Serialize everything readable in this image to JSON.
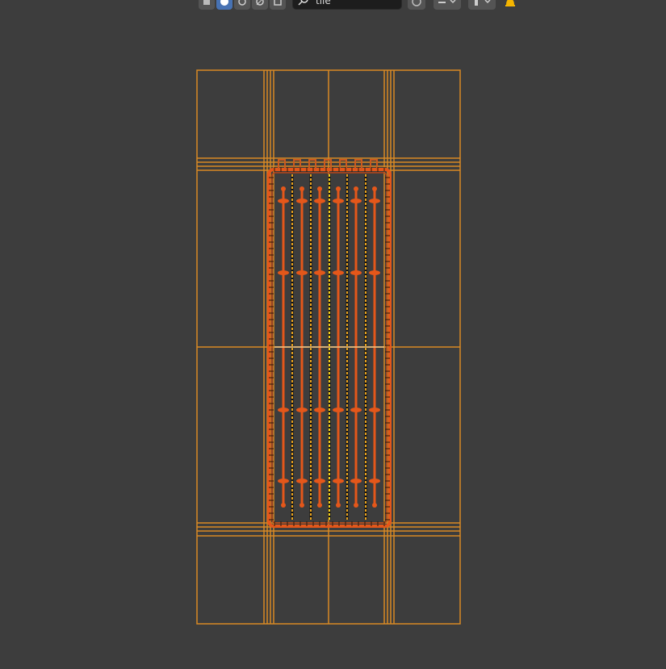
{
  "header": {
    "search": {
      "value": "tile"
    }
  },
  "icons": {
    "mode_buttons": [
      "box-select-icon",
      "shading-icon",
      "render-icon",
      "overlay-icon",
      "xray-icon"
    ],
    "right": [
      "shading-sphere-icon",
      "gizmo-dropdown-icon",
      "light-dropdown-icon",
      "notification-bell-icon"
    ]
  },
  "colors": {
    "background": "#3d3d3d",
    "wireframe": "#e59b2d",
    "selected": "#e4571a",
    "active_button": "#4772b3"
  },
  "viewport": {
    "object_name": "tile"
  }
}
